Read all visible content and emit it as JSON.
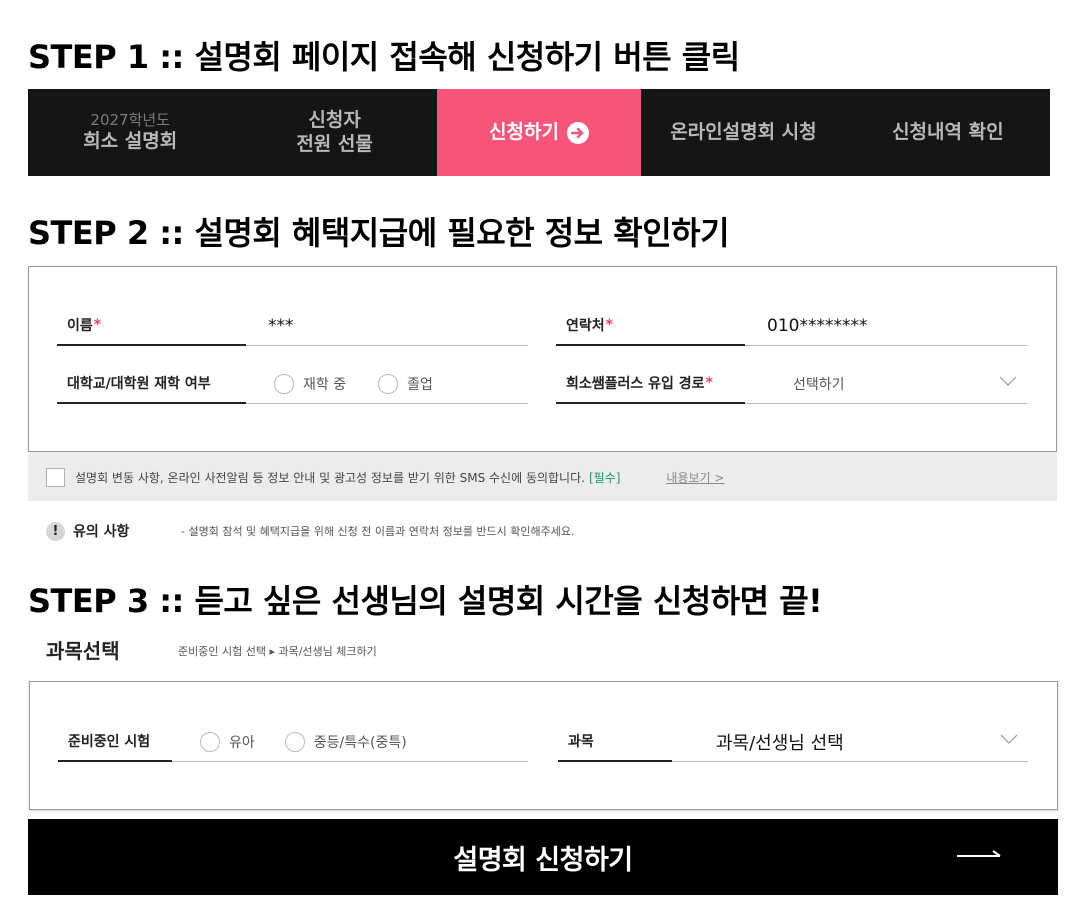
{
  "steps": {
    "step1": "STEP 1 :: 설명회 페이지 접속해 신청하기 버튼 클릭",
    "step2": "STEP 2 :: 설명회 혜택지급에 필요한 정보 확인하기",
    "step3": "STEP 3 :: 듣고 싶은 선생님의 설명회 시간을 신청하면 끝!"
  },
  "nav": {
    "item1_sub": "2027학년도",
    "item1_main": "희소 설명회",
    "item2_line1": "신청자",
    "item2_line2": "전원 선물",
    "item3": "신청하기",
    "item4": "온라인설명회 시청",
    "item5": "신청내역 확인"
  },
  "form": {
    "name_label": "이름",
    "name_value": "***",
    "phone_label": "연락처",
    "phone_value": "010********",
    "enroll_label": "대학교/대학원 재학 여부",
    "enroll_options": [
      "재학 중",
      "졸업"
    ],
    "source_label": "희소쌤플러스 유입 경로",
    "source_placeholder": "선택하기",
    "required_mark": "*"
  },
  "consent": {
    "text": "설명회 변동 사항, 온라인 사전알림 등 정보 안내 및 광고성 정보를 받기 위한 SMS 수신에 동의합니다.",
    "required": "[필수]",
    "view_link": "내용보기 >"
  },
  "notice": {
    "icon": "!",
    "label": "유의 사항",
    "text": "- 설명회 참석 및 혜택지급을 위해 신청 전 이름과 연락처 정보를 반드시 확인해주세요."
  },
  "subject": {
    "title": "과목선택",
    "breadcrumb": "준비중인 시험 선택 ▸ 과목/선생님 체크하기",
    "exam_label": "준비중인 시험",
    "exam_options": [
      "유아",
      "중등/특수(중특)"
    ],
    "subject_label": "과목",
    "subject_value": "과목/선생님 선택"
  },
  "submit": {
    "label": "설명회 신청하기"
  },
  "colors": {
    "accent": "#f7567a",
    "nav_bg": "#151515",
    "required": "#f04163",
    "consent_required": "#1a9a64"
  }
}
